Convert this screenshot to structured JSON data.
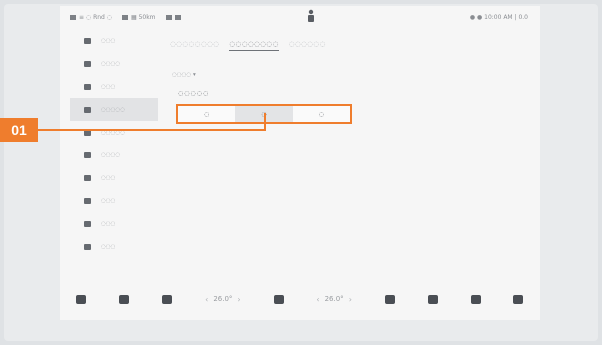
{
  "topbar": {
    "left_items": [
      "≡ ◌ Rnd ◌",
      "▦ 50km"
    ],
    "right_time": "● ● 10:00 AM | 0.0"
  },
  "sidebar": {
    "items": [
      {
        "label": "◌◌◌",
        "icon": "car-icon",
        "active": false
      },
      {
        "label": "◌◌◌◌",
        "icon": "light-icon",
        "active": false
      },
      {
        "label": "◌◌◌",
        "icon": "lock-icon",
        "active": false
      },
      {
        "label": "◌◌◌◌◌",
        "icon": "display-icon",
        "active": true
      },
      {
        "label": "◌◌◌◌◌",
        "icon": "drive-icon",
        "active": false
      },
      {
        "label": "◌◌◌◌",
        "icon": "seat-icon",
        "active": false
      },
      {
        "label": "◌◌◌",
        "icon": "safety-icon",
        "active": false
      },
      {
        "label": "◌◌◌",
        "icon": "service-icon",
        "active": false
      },
      {
        "label": "◌◌◌",
        "icon": "network-icon",
        "active": false
      },
      {
        "label": "◌◌◌",
        "icon": "settings-icon",
        "active": false
      }
    ]
  },
  "tabs": [
    {
      "label": "◌◌◌◌◌◌◌◌",
      "active": false
    },
    {
      "label": "◌◌◌◌◌◌◌◌",
      "active": true
    },
    {
      "label": "◌◌◌◌◌◌",
      "active": false
    }
  ],
  "control_type": "◌◌◌◌ ▾",
  "group_label": "◌◌◌◌◌",
  "segmented": {
    "options": [
      "◌",
      "◌",
      "◌"
    ],
    "selected_index": 1
  },
  "callout": {
    "number": "01",
    "color": "#ef7d2d"
  },
  "bottombar": {
    "temp_left": "26.0°",
    "temp_right": "26.0°",
    "items": [
      "home-icon",
      "car-icon",
      "fan-icon",
      "seat-heat-icon",
      "defrost-icon",
      "music-icon",
      "grid-icon",
      "phone-icon"
    ]
  }
}
